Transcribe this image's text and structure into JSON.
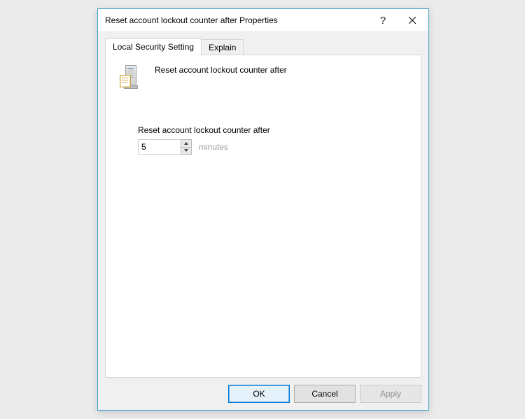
{
  "dialog": {
    "title": "Reset account lockout counter after Properties"
  },
  "tabs": {
    "local": "Local Security Setting",
    "explain": "Explain"
  },
  "policy": {
    "heading": "Reset account lockout counter after",
    "setting_label": "Reset account lockout counter after",
    "value": "5",
    "unit": "minutes"
  },
  "buttons": {
    "ok": "OK",
    "cancel": "Cancel",
    "apply": "Apply"
  }
}
